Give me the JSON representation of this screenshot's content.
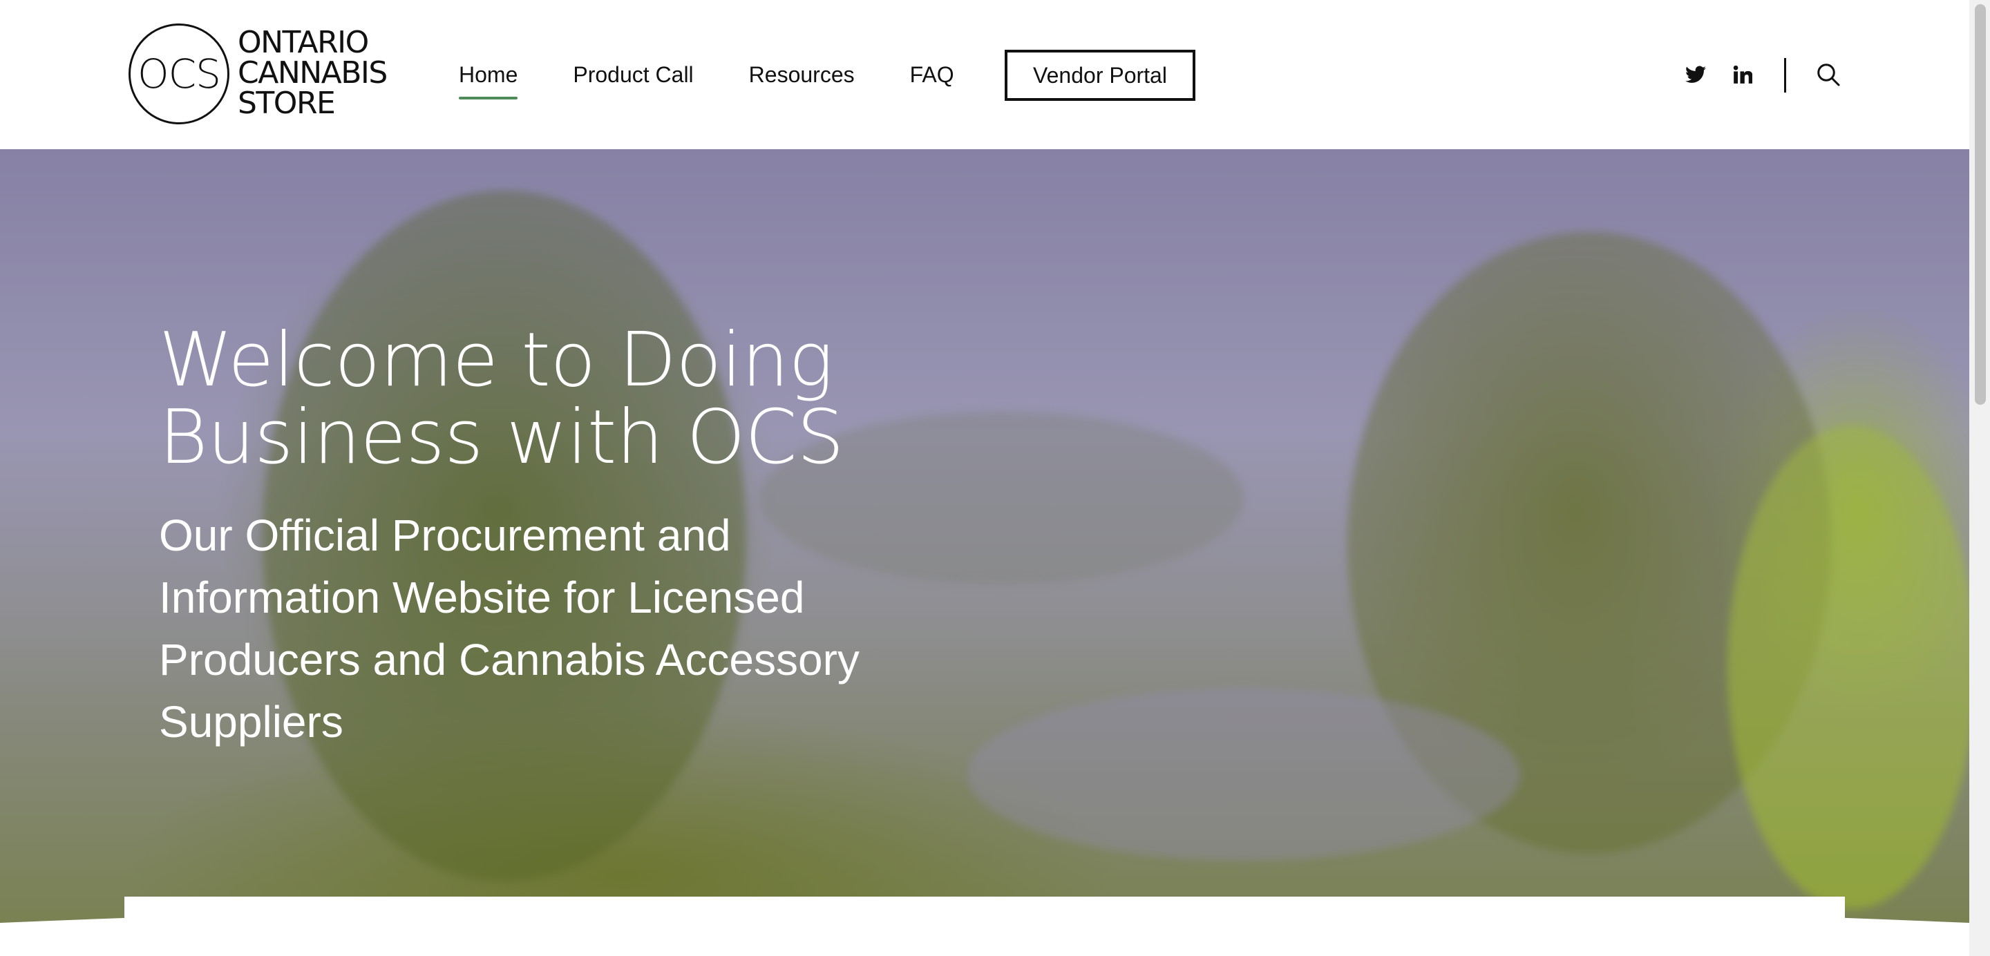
{
  "header": {
    "logo": {
      "mark": "OCS",
      "words": [
        "ONTARIO",
        "CANNABIS",
        "STORE"
      ]
    },
    "nav": [
      {
        "label": "Home",
        "active": true
      },
      {
        "label": "Product Call",
        "active": false
      },
      {
        "label": "Resources",
        "active": false
      },
      {
        "label": "FAQ",
        "active": false
      }
    ],
    "vendor_portal_label": "Vendor Portal",
    "icons": {
      "twitter": "twitter-icon",
      "linkedin": "linkedin-icon",
      "search": "search-icon"
    }
  },
  "hero": {
    "title": "Welcome to Doing Business with OCS",
    "subtitle": "Our Official Procurement and Information Website for Licensed Producers and Cannabis Accessory Suppliers"
  },
  "colors": {
    "accent": "#4f8a5b",
    "text": "#111111",
    "hero_text": "#ffffff"
  }
}
